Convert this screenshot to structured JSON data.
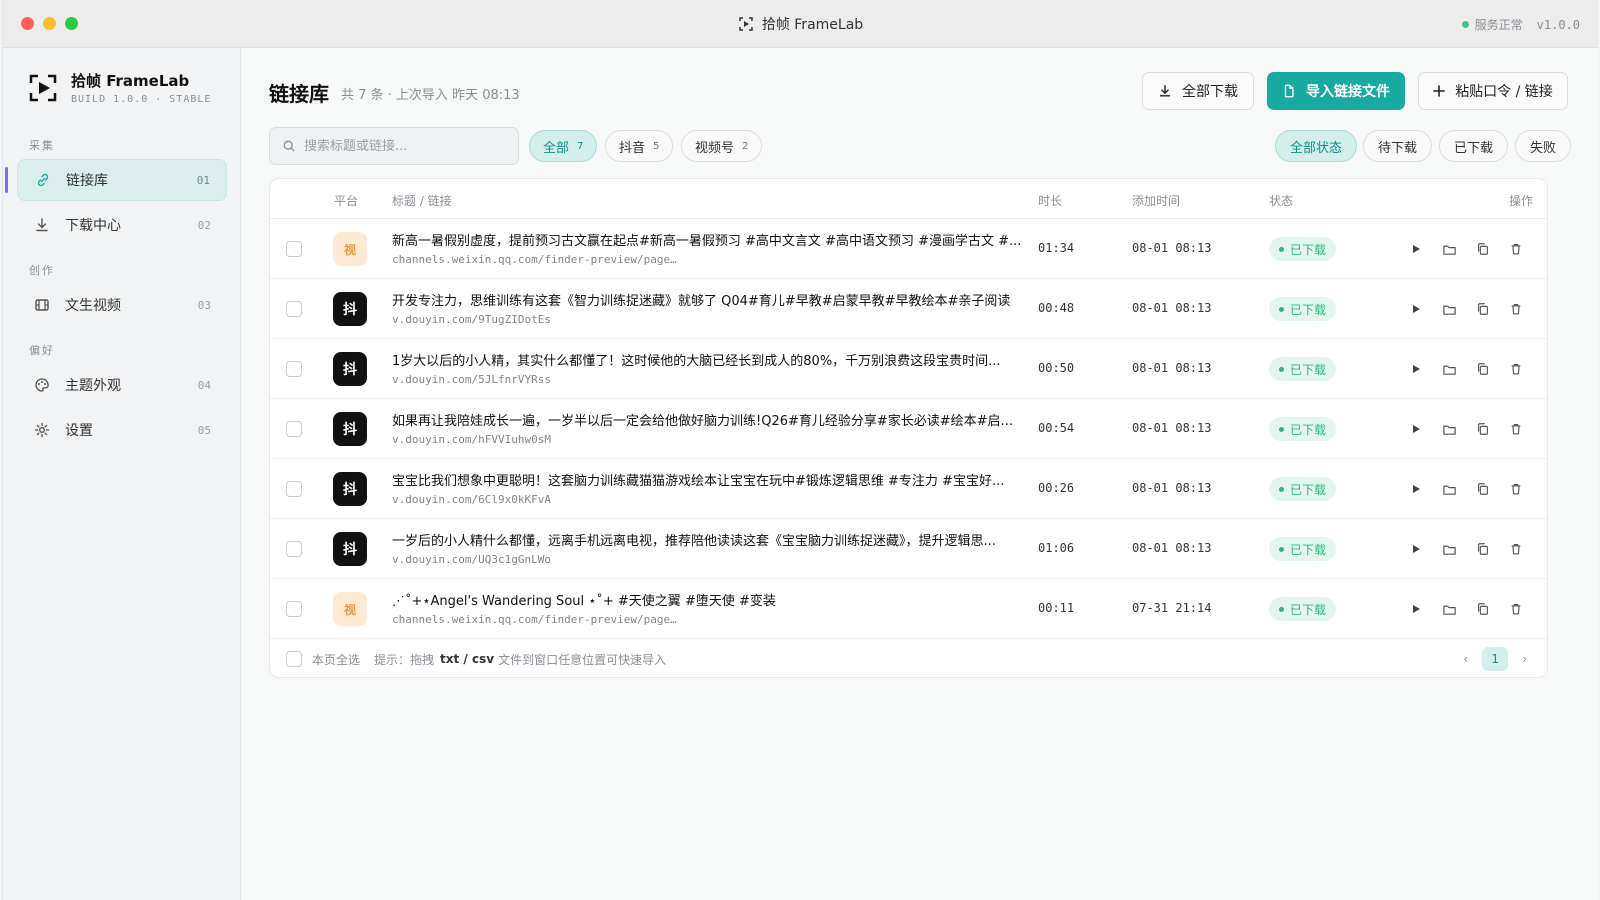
{
  "window": {
    "title": "拾帧 FrameLab",
    "status": "服务正常",
    "version": "v1.0.0",
    "accent_color": "#18aaa0"
  },
  "sidebar": {
    "brand_name": "拾帧 FrameLab",
    "brand_build": "BUILD 1.0.0 · STABLE",
    "sections": {
      "collect": "采集",
      "create": "创作",
      "prefs": "偏好"
    },
    "items": [
      {
        "label": "链接库",
        "num": "01",
        "icon": "link-icon"
      },
      {
        "label": "下载中心",
        "num": "02",
        "icon": "download-icon"
      },
      {
        "label": "文生视频",
        "num": "03",
        "icon": "film-icon"
      },
      {
        "label": "主题外观",
        "num": "04",
        "icon": "palette-icon"
      },
      {
        "label": "设置",
        "num": "05",
        "icon": "gear-icon"
      }
    ]
  },
  "header": {
    "title": "链接库",
    "subtitle": "共 7 条 · 上次导入 昨天 08:13",
    "download_all": "全部下载",
    "import_file": "导入链接文件",
    "paste_link": "粘贴口令 / 链接"
  },
  "search": {
    "placeholder": "搜索标题或链接..."
  },
  "platform_filters": [
    {
      "label": "全部",
      "count": "7"
    },
    {
      "label": "抖音",
      "count": "5"
    },
    {
      "label": "视频号",
      "count": "2"
    }
  ],
  "status_filters": [
    "全部状态",
    "待下载",
    "已下载",
    "失败"
  ],
  "table": {
    "headers": {
      "platform": "平台",
      "title": "标题 / 链接",
      "duration": "时长",
      "added": "添加时间",
      "status": "状态",
      "actions": "操作"
    },
    "rows": [
      {
        "platform": "wx",
        "icon_text": "视",
        "title": "新高一暑假别虚度，提前预习古文赢在起点#新高一暑假预习 #高中文言文 #高中语文预习 #漫画学古文 #...",
        "link": "channels.weixin.qq.com/finder-preview/page…",
        "duration": "01:34",
        "added": "08-01 08:13",
        "status": "已下载"
      },
      {
        "platform": "douyin",
        "icon_text": "抖",
        "title": "开发专注力，思维训练有这套《智力训练捉迷藏》就够了 Q04#育儿#早教#启蒙早教#早教绘本#亲子阅读",
        "link": "v.douyin.com/9TugZIDotEs",
        "duration": "00:48",
        "added": "08-01 08:13",
        "status": "已下载"
      },
      {
        "platform": "douyin",
        "icon_text": "抖",
        "title": "1岁大以后的小人精，其实什么都懂了！这时候他的大脑已经长到成人的80%，千万别浪费这段宝贵时间...",
        "link": "v.douyin.com/5JLfnrVYRss",
        "duration": "00:50",
        "added": "08-01 08:13",
        "status": "已下载"
      },
      {
        "platform": "douyin",
        "icon_text": "抖",
        "title": "如果再让我陪娃成长一遍，一岁半以后一定会给他做好脑力训练!Q26#育儿经验分享#家长必读#绘本#启...",
        "link": "v.douyin.com/hFVVIuhw0sM",
        "duration": "00:54",
        "added": "08-01 08:13",
        "status": "已下载"
      },
      {
        "platform": "douyin",
        "icon_text": "抖",
        "title": "宝宝比我们想象中更聪明！这套脑力训练藏猫猫游戏绘本让宝宝在玩中#锻炼逻辑思维 #专注力 #宝宝好...",
        "link": "v.douyin.com/6Cl9x0kKFvA",
        "duration": "00:26",
        "added": "08-01 08:13",
        "status": "已下载"
      },
      {
        "platform": "douyin",
        "icon_text": "抖",
        "title": "一岁后的小人精什么都懂，远离手机远离电视，推荐陪他读读这套《宝宝脑力训练捉迷藏》，提升逻辑思...",
        "link": "v.douyin.com/UQ3c1gGnLWo",
        "duration": "01:06",
        "added": "08-01 08:13",
        "status": "已下载"
      },
      {
        "platform": "wx",
        "icon_text": "视",
        "title": "⋰˚+⋆Angel's Wandering Soul ⋆˚+ #天使之翼 #堕天使 #变装",
        "link": "channels.weixin.qq.com/finder-preview/page…",
        "duration": "00:11",
        "added": "07-31 21:14",
        "status": "已下载"
      }
    ]
  },
  "footer": {
    "select_page": "本页全选",
    "hint_prefix": "提示：拖拽",
    "hint_ext": "txt / csv",
    "hint_suffix": "文件到窗口任意位置可快速导入",
    "page": "1"
  }
}
